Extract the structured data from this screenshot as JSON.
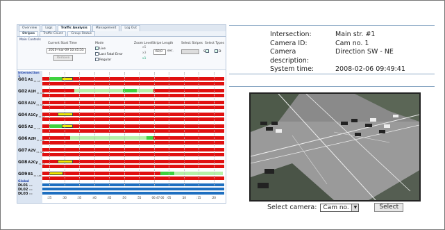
{
  "nav": {
    "tabs": [
      "Overview",
      "Logs",
      "Traffic Analysis",
      "Management",
      "Log Out"
    ],
    "active": "Traffic Analysis",
    "subtabs": [
      "Stripes",
      "Traffic Count",
      "Group Status"
    ],
    "active_sub": "Stripes"
  },
  "controls": {
    "title": "Main Controls",
    "current_start_time_label": "Current Start Time",
    "current_start_time": "2010-mar-09 10:45:55",
    "remove_label": "Remove",
    "mode_label": "Mode",
    "mode_options": [
      "Live",
      "Last Fatal Error",
      "Regular"
    ],
    "zoom_label": "Zoom Level",
    "zoom_levels": [
      "x5",
      "x3",
      "x1"
    ],
    "stripe_length_label": "Stripe Length",
    "stripe_length_value": "60,0",
    "stripe_length_unit": "sec.",
    "select_stripes_label": "Select Stripes",
    "select_types_label": "Select Types",
    "select_types_values": [
      "S",
      "D"
    ]
  },
  "grid": {
    "section_intersection": "Intersection 1",
    "groups": [
      {
        "id": "G01",
        "name": "A1",
        "tag": "R1 A8"
      },
      {
        "id": "G02",
        "name": "A1H",
        "tag": "R1 A8D"
      },
      {
        "id": "G03",
        "name": "A1V",
        "tag": "R1 A8V"
      },
      {
        "id": "G04",
        "name": "A1Cy",
        "tag": "R1 A8"
      },
      {
        "id": "G05",
        "name": "A2",
        "tag": "R1 A8"
      },
      {
        "id": "G06",
        "name": "A2H",
        "tag": "R1 A8D"
      },
      {
        "id": "G07",
        "name": "A2V",
        "tag": "R1 A8V"
      },
      {
        "id": "G08",
        "name": "A2Cy",
        "tag": "R1 A8"
      },
      {
        "id": "G09",
        "name": "B1",
        "tag": "R1 A8B"
      }
    ],
    "section_global": "Global",
    "detectors": [
      {
        "id": "DL01",
        "tag": "D0"
      },
      {
        "id": "DL02",
        "tag": "D0"
      },
      {
        "id": "DL03",
        "tag": "D0"
      }
    ],
    "time_ticks": [
      ":25",
      ":30",
      ":35",
      ":40",
      ":45",
      ":50",
      ":55",
      "00:47:00",
      ":05",
      ":10",
      ":15",
      ":20"
    ]
  },
  "info": {
    "intersection_label": "Intersection:",
    "intersection": "Main str. #1",
    "camera_id_label": "Camera ID:",
    "camera_id": "Cam no. 1",
    "camera_desc_label": "Camera description:",
    "camera_desc": "Direction SW - NE",
    "system_time_label": "System time:",
    "system_time": "2008-02-06 09:49:41"
  },
  "camera": {
    "select_label": "Select camera:",
    "selected": "Cam no. 1",
    "select_button": "Select"
  },
  "colors": {
    "red": "#e01010",
    "green": "#3fd23f",
    "yellow": "#f0e400",
    "detector_blue": "#1e6fc0",
    "accent": "#8aa8c4"
  }
}
